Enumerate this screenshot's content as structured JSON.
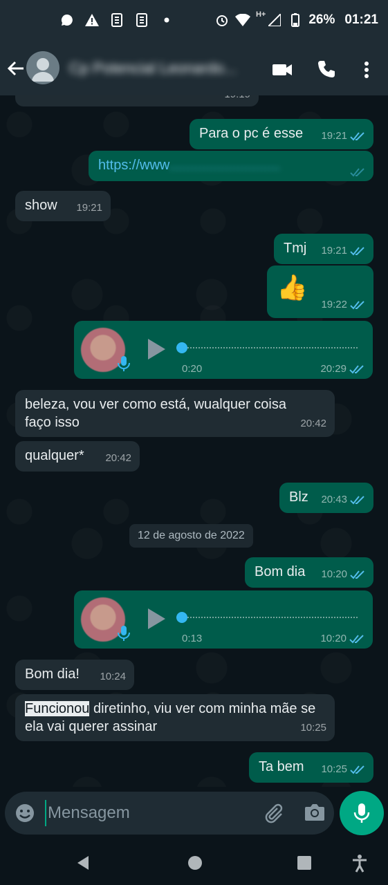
{
  "status_bar": {
    "battery": "26%",
    "time": "01:21",
    "network": "H+"
  },
  "header": {
    "contact_name": "Cp Potencial Leonardo...",
    "icons": [
      "back-arrow-icon",
      "avatar",
      "video-call-icon",
      "phone-icon",
      "more-vert-icon"
    ]
  },
  "messages": [
    {
      "dir": "in",
      "text": "...",
      "time": "19:19",
      "partial": true
    },
    {
      "dir": "out",
      "text": "Para o pc é esse",
      "time": "19:21",
      "ticks": "read"
    },
    {
      "dir": "out",
      "text": "https://www",
      "time": "",
      "ticks": "read",
      "link": true
    },
    {
      "dir": "in",
      "text": "show",
      "time": "19:21"
    },
    {
      "dir": "out",
      "text": "Tmj",
      "time": "19:21",
      "ticks": "read"
    },
    {
      "dir": "out",
      "text": "👍",
      "time": "19:22",
      "ticks": "read"
    },
    {
      "dir": "out",
      "type": "voice",
      "duration": "0:20",
      "time": "20:29",
      "ticks": "read"
    },
    {
      "dir": "in",
      "text": "beleza, vou ver como está, wualquer coisa faço isso",
      "time": "20:42"
    },
    {
      "dir": "in",
      "text": "qualquer*",
      "time": "20:42"
    },
    {
      "dir": "out",
      "text": "Blz",
      "time": "20:43",
      "ticks": "read"
    },
    {
      "type": "date",
      "text": "12 de agosto de 2022"
    },
    {
      "dir": "out",
      "text": "Bom dia",
      "time": "10:20",
      "ticks": "read"
    },
    {
      "dir": "out",
      "type": "voice",
      "duration": "0:13",
      "time": "10:20",
      "ticks": "read"
    },
    {
      "dir": "in",
      "text": "Bom dia!",
      "time": "10:24"
    },
    {
      "dir": "in",
      "text_highlight": "Funcionou",
      "text_rest": " diretinho, viu ver com minha mãe se ela vai querer assinar",
      "time": "10:25"
    },
    {
      "dir": "out",
      "text": "Ta bem",
      "time": "10:25",
      "ticks": "read"
    }
  ],
  "composer": {
    "placeholder": "Mensagem"
  },
  "colors": {
    "bg": "#0b141a",
    "incoming": "#202c33",
    "outgoing": "#005c4b",
    "accent": "#00a884",
    "read_ticks": "#53bdeb"
  }
}
